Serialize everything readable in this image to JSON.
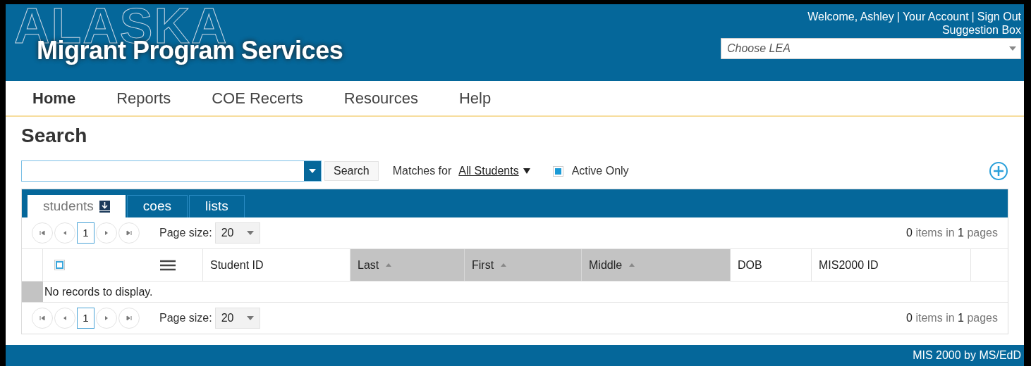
{
  "header": {
    "logo_outline": "ALASKA",
    "logo_title": "Migrant Program Services",
    "user_bar": {
      "welcome": "Welcome, Ashley",
      "separator_1": "|",
      "account_link": "Your Account",
      "separator_2": "|",
      "sign_out_link": "Sign Out"
    },
    "suggestion_link": "Suggestion Box",
    "lea_select": {
      "placeholder": "Choose LEA"
    }
  },
  "nav": [
    {
      "label": "Home",
      "selected": true
    },
    {
      "label": "Reports",
      "selected": false
    },
    {
      "label": "COE Recerts",
      "selected": false
    },
    {
      "label": "Resources",
      "selected": false
    },
    {
      "label": "Help",
      "selected": false
    }
  ],
  "page_title": "Search",
  "search": {
    "button": "Search",
    "matches_label": "Matches for",
    "matches_value": "All Students",
    "active_only": {
      "label": "Active Only",
      "checked": true
    }
  },
  "grid": {
    "tabs": [
      {
        "label": "students",
        "selected": true,
        "download": true
      },
      {
        "label": "coes",
        "selected": false,
        "download": false
      },
      {
        "label": "lists",
        "selected": false,
        "download": false
      }
    ],
    "pagers": [
      {
        "current": "1",
        "page_size_label": "Page size:",
        "page_size": "20",
        "count": "0",
        "items_in": "items in",
        "pages": "1",
        "pages_label": "pages"
      },
      {
        "current": "1",
        "page_size_label": "Page size:",
        "page_size": "20",
        "count": "0",
        "items_in": "items in",
        "pages": "1",
        "pages_label": "pages"
      }
    ],
    "select_all": {
      "checked": false
    },
    "columns": [
      {
        "label": "Student ID",
        "sorted": false
      },
      {
        "label": "Last",
        "sorted": true
      },
      {
        "label": "First",
        "sorted": true
      },
      {
        "label": "Middle",
        "sorted": true
      },
      {
        "label": "DOB",
        "sorted": false
      },
      {
        "label": "MIS2000 ID",
        "sorted": false
      }
    ],
    "empty_message": "No records to display."
  },
  "footer": "MIS 2000 by MS/EdD"
}
